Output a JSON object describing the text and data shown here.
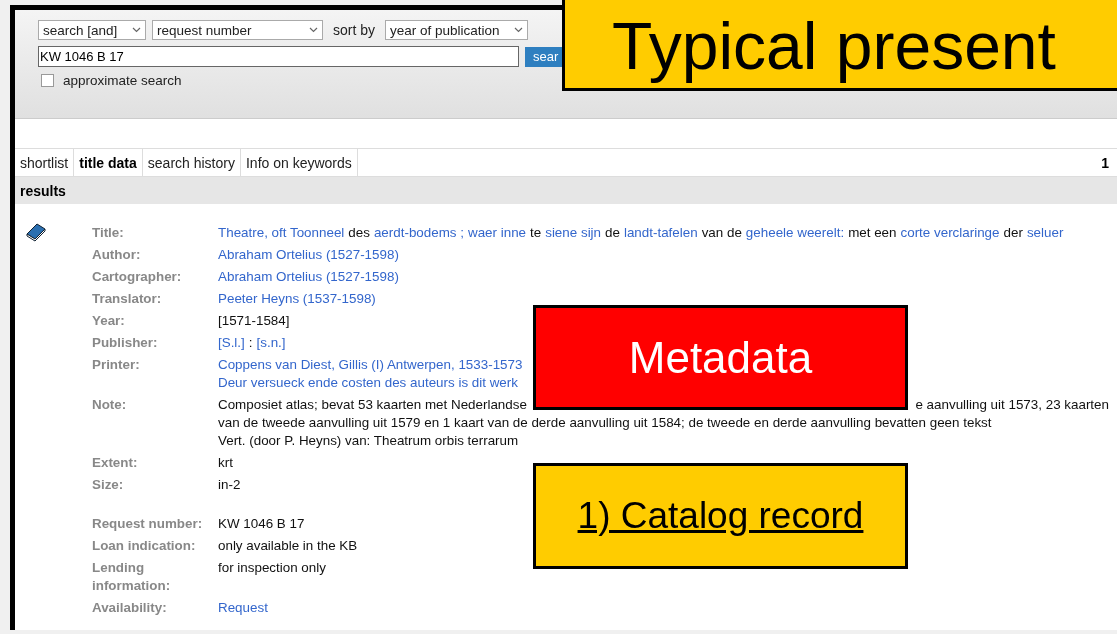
{
  "search_form": {
    "mode_select": "search [and]",
    "field_select": "request number",
    "sort_label": "sort by",
    "sort_select": "year of publication",
    "query": "KW 1046 B 17",
    "search_button": "sear",
    "approximate": {
      "label": "approximate search",
      "checked": false
    }
  },
  "tabs": [
    {
      "label": "shortlist",
      "selected": false
    },
    {
      "label": "title data",
      "selected": true
    },
    {
      "label": "search history",
      "selected": false
    },
    {
      "label": "Info on keywords",
      "selected": false
    }
  ],
  "tab_count": "1",
  "results_header": "results",
  "record": {
    "groups": [
      {
        "fields": [
          {
            "label": "Title:",
            "lines": [
              {
                "segments": [
                  {
                    "text": "Theatre, oft Toonneel",
                    "link": true
                  },
                  {
                    "text": "des",
                    "link": false
                  },
                  {
                    "text": "aerdt-bodems ;",
                    "link": true
                  },
                  {
                    "text": "waer inne",
                    "link": true
                  },
                  {
                    "text": "te",
                    "link": false
                  },
                  {
                    "text": "siene sijn",
                    "link": true
                  },
                  {
                    "text": "de",
                    "link": false
                  },
                  {
                    "text": "landt-tafelen",
                    "link": true
                  },
                  {
                    "text": "van de",
                    "link": false
                  },
                  {
                    "text": "geheele weerelt:",
                    "link": true
                  },
                  {
                    "text": "met een",
                    "link": false
                  },
                  {
                    "text": "corte verclaringe",
                    "link": true
                  },
                  {
                    "text": "der",
                    "link": false
                  },
                  {
                    "text": "seluer",
                    "link": true
                  }
                ]
              }
            ]
          },
          {
            "label": "Author:",
            "lines": [
              {
                "segments": [
                  {
                    "text": "Abraham Ortelius (1527-1598)",
                    "link": true
                  }
                ]
              }
            ]
          },
          {
            "label": "Cartographer:",
            "lines": [
              {
                "segments": [
                  {
                    "text": "Abraham Ortelius (1527-1598)",
                    "link": true
                  }
                ]
              }
            ]
          },
          {
            "label": "Translator:",
            "lines": [
              {
                "segments": [
                  {
                    "text": "Peeter Heyns (1537-1598)",
                    "link": true
                  }
                ]
              }
            ]
          },
          {
            "label": "Year:",
            "lines": [
              {
                "segments": [
                  {
                    "text": "[1571-1584]",
                    "link": false
                  }
                ]
              }
            ]
          },
          {
            "label": "Publisher:",
            "lines": [
              {
                "segments": [
                  {
                    "text": "[S.l.]",
                    "link": true
                  },
                  {
                    "text": ":",
                    "link": false
                  },
                  {
                    "text": "[s.n.]",
                    "link": true
                  }
                ]
              }
            ]
          },
          {
            "label": "Printer:",
            "lines": [
              {
                "segments": [
                  {
                    "text": "Coppens van Diest, Gillis (I) Antwerpen, 1533-1573",
                    "link": true
                  }
                ]
              },
              {
                "segments": [
                  {
                    "text": "Deur versueck ende costen des auteurs is dit werk",
                    "link": true
                  }
                ]
              }
            ]
          },
          {
            "label": "Note:",
            "lines": [
              {
                "segments": [
                  {
                    "text": "Composiet atlas; bevat 53 kaarten met Nederlandse",
                    "link": false
                  }
                ],
                "right_segments": [
                  {
                    "text": "e aanvulling uit 1573, 23 kaarten",
                    "link": false
                  }
                ]
              },
              {
                "segments": [
                  {
                    "text": "van de tweede aanvulling uit 1579 en 1 kaart van de derde aanvulling uit 1584; de tweede en derde aanvulling bevatten geen tekst",
                    "link": false
                  }
                ]
              },
              {
                "segments": [
                  {
                    "text": "Vert. (door P. Heyns) van: Theatrum orbis terrarum",
                    "link": false
                  }
                ]
              }
            ]
          },
          {
            "label": "Extent:",
            "lines": [
              {
                "segments": [
                  {
                    "text": "krt",
                    "link": false
                  }
                ]
              }
            ]
          },
          {
            "label": "Size:",
            "lines": [
              {
                "segments": [
                  {
                    "text": "in-2",
                    "link": false
                  }
                ]
              }
            ]
          }
        ]
      },
      {
        "fields": [
          {
            "label": "Request number:",
            "lines": [
              {
                "segments": [
                  {
                    "text": "KW 1046 B 17",
                    "link": false
                  }
                ]
              }
            ]
          },
          {
            "label": "Loan indication:",
            "lines": [
              {
                "segments": [
                  {
                    "text": "only available in the KB",
                    "link": false
                  }
                ]
              }
            ]
          },
          {
            "label": "Lending information:",
            "lines": [
              {
                "segments": [
                  {
                    "text": "for inspection only",
                    "link": false
                  }
                ]
              }
            ]
          },
          {
            "label": "Availability:",
            "lines": [
              {
                "segments": [
                  {
                    "text": "Request",
                    "link": true
                  }
                ]
              }
            ]
          }
        ]
      }
    ]
  },
  "callouts": [
    {
      "kind": "title",
      "text": "Typical present"
    },
    {
      "kind": "red",
      "text": "Metadata"
    },
    {
      "kind": "yellow",
      "text": "1) Catalog record"
    }
  ]
}
